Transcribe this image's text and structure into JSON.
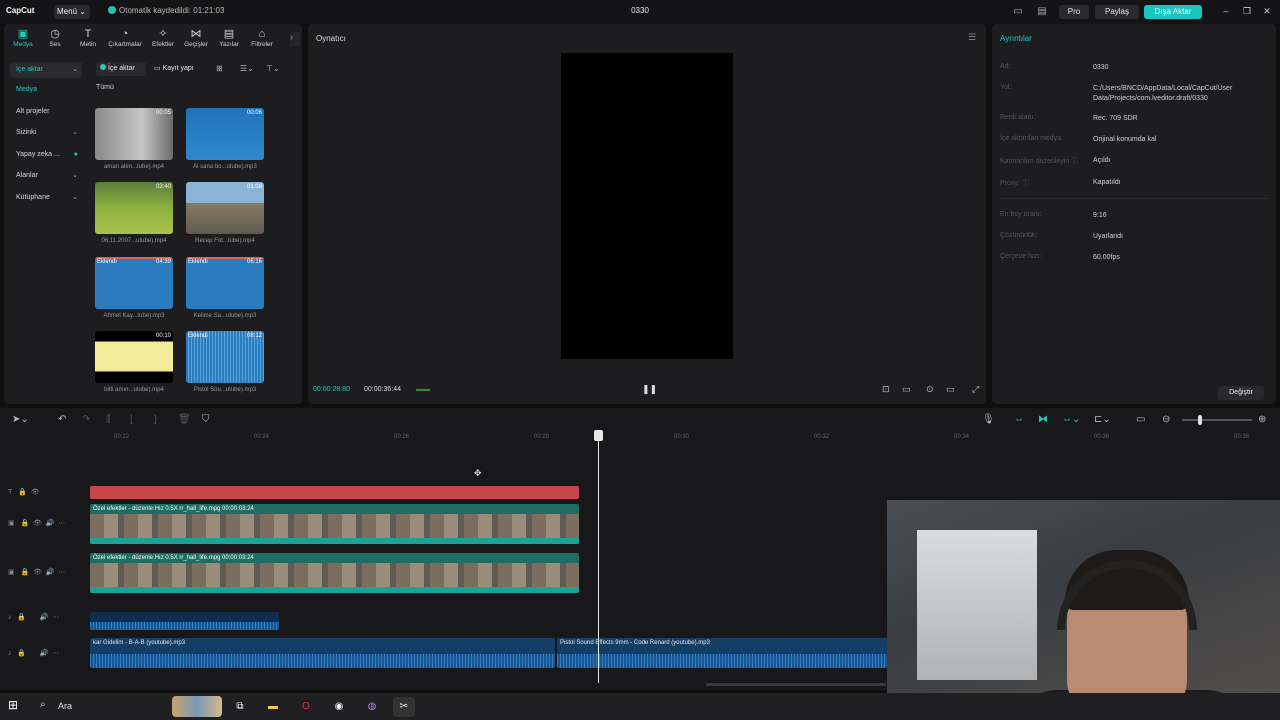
{
  "topbar": {
    "logo": "CapCut",
    "menu": "Menü",
    "autosave": "Otomatik kaydedildi: 01:21:03",
    "title": "0330",
    "pro": "Pro",
    "share": "Paylaş",
    "export": "Dışa Aktar"
  },
  "tools": [
    {
      "label": "Medya",
      "icon": "▣"
    },
    {
      "label": "Ses",
      "icon": "◷"
    },
    {
      "label": "Metin",
      "icon": "T"
    },
    {
      "label": "Çıkartmalar",
      "icon": "◔"
    },
    {
      "label": "Efektler",
      "icon": "✧"
    },
    {
      "label": "Geçişler",
      "icon": "⋈"
    },
    {
      "label": "Yazılar",
      "icon": "▤"
    },
    {
      "label": "Filtreler",
      "icon": "⌂"
    }
  ],
  "sidebar": {
    "import": "İçe aktar",
    "media": "Medya",
    "sub_projects": "Alt projeler",
    "yours": "Sizinki",
    "ai": "Yapay zeka ...",
    "spaces": "Alanlar",
    "library": "Kütüphane"
  },
  "media_toolbar": {
    "import_btn": "İçe aktar",
    "record_btn": "Kayıt yapı",
    "all": "Tümü"
  },
  "media_items": [
    {
      "name": "aman alen...tube).mp4",
      "duration": "00:05",
      "added": ""
    },
    {
      "name": "Ai sana bo...utube).mp3",
      "duration": "00:06",
      "added": ""
    },
    {
      "name": "06.11.2007...utube).mp4",
      "duration": "03:40",
      "added": ""
    },
    {
      "name": "Recep Fot...tube).mp4",
      "duration": "01:08",
      "added": ""
    },
    {
      "name": "Ahmet Kay...tube).mp3",
      "duration": "04:39",
      "added": "Eklendi"
    },
    {
      "name": "Kelime Sa...utube).mp3",
      "duration": "06:16",
      "added": "Eklendi"
    },
    {
      "name": "bitti amın...utube).mp4",
      "duration": "00:10",
      "added": ""
    },
    {
      "name": "Pistol Sou...utube).mp3",
      "duration": "08:12",
      "added": "Eklendi"
    }
  ],
  "player": {
    "title": "Oynatıcı",
    "current": "00:00:28:80",
    "total": "00:00:36:44"
  },
  "details": {
    "title": "Ayrıntılar",
    "rows": [
      {
        "label": "Ad:",
        "value": "0330"
      },
      {
        "label": "Yol:",
        "value": "C:/Users/BNCD/AppData/Local/CapCut/User Data/Projects/com.lveditor.draft/0330"
      },
      {
        "label": "Renk alanı:",
        "value": "Rec. 709 SDR"
      },
      {
        "label": "İçe aktarılan medya:",
        "value": "Orijinal konumda kal"
      },
      {
        "label": "Katmanları düzenleyin ⓘ",
        "value": "Açıldı"
      },
      {
        "label": "Proxy: ⓘ",
        "value": "Kapatıldı"
      },
      {
        "label": "En boy oranı:",
        "value": "9:16"
      },
      {
        "label": "Çözünürlük:",
        "value": "Uyarlandı"
      },
      {
        "label": "Çerçeve hızı:",
        "value": "60.00fps"
      }
    ],
    "change": "Değiştir"
  },
  "timeline": {
    "ticks": [
      "00:22",
      "00:24",
      "00:26",
      "00:28",
      "00:30",
      "00:32",
      "00:34",
      "00:36",
      "00:38"
    ],
    "video_caption": "Özel efektler - düzenle   Hız 0.5X   rr_hall_life.mpg  00:00:03:24",
    "video_caption_2": "Özel efektler - düzenle   Hız 0.5X   rr_hall_life.mpg  00:00:03:24",
    "audio1": "kar Gidelim - B-A-B (youtube).mp3",
    "audio2": "Pistol Sound Effects 9mm - Code Renard (youtube).mp3"
  },
  "taskbar": {
    "search": "Ara"
  }
}
